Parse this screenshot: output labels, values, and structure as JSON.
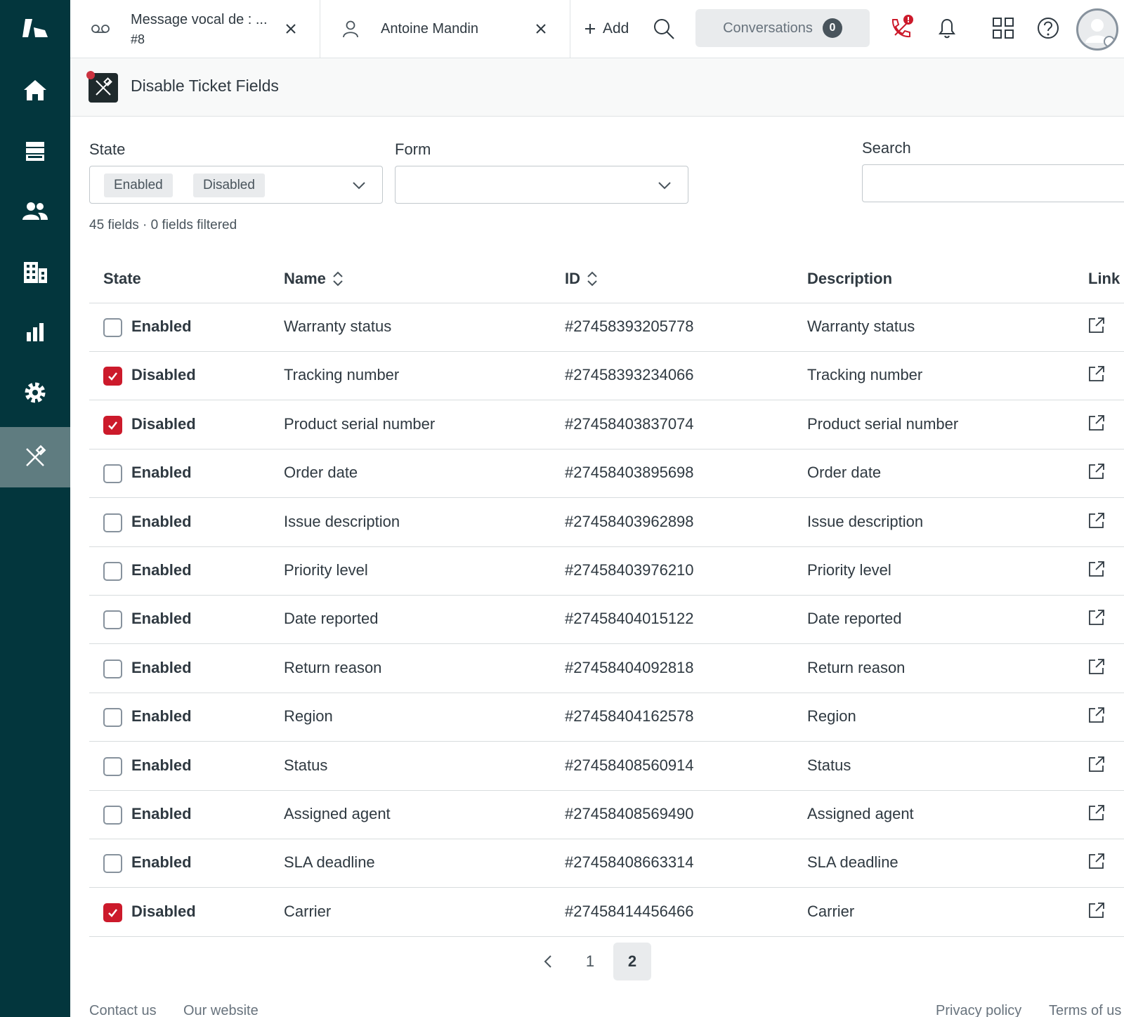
{
  "topbar": {
    "tabs": [
      {
        "title": "Message vocal de : ...",
        "sub": "#8"
      },
      {
        "title": "Antoine Mandin"
      }
    ],
    "add_label": "Add",
    "conversations_label": "Conversations",
    "conversations_count": "0"
  },
  "app": {
    "title": "Disable Ticket Fields"
  },
  "filters": {
    "state_label": "State",
    "state_chips": [
      "Enabled",
      "Disabled"
    ],
    "form_label": "Form",
    "search_label": "Search",
    "search_value": ""
  },
  "summary": "45 fields · 0 fields filtered",
  "table": {
    "headers": {
      "state": "State",
      "name": "Name",
      "id": "ID",
      "description": "Description",
      "link": "Link"
    },
    "rows": [
      {
        "checked": false,
        "state": "Enabled",
        "name": "Warranty status",
        "id": "#27458393205778",
        "description": "Warranty status"
      },
      {
        "checked": true,
        "state": "Disabled",
        "name": "Tracking number",
        "id": "#27458393234066",
        "description": "Tracking number"
      },
      {
        "checked": true,
        "state": "Disabled",
        "name": "Product serial number",
        "id": "#27458403837074",
        "description": "Product serial number"
      },
      {
        "checked": false,
        "state": "Enabled",
        "name": "Order date",
        "id": "#27458403895698",
        "description": "Order date"
      },
      {
        "checked": false,
        "state": "Enabled",
        "name": "Issue description",
        "id": "#27458403962898",
        "description": "Issue description"
      },
      {
        "checked": false,
        "state": "Enabled",
        "name": "Priority level",
        "id": "#27458403976210",
        "description": "Priority level"
      },
      {
        "checked": false,
        "state": "Enabled",
        "name": "Date reported",
        "id": "#27458404015122",
        "description": "Date reported"
      },
      {
        "checked": false,
        "state": "Enabled",
        "name": "Return reason",
        "id": "#27458404092818",
        "description": "Return reason"
      },
      {
        "checked": false,
        "state": "Enabled",
        "name": "Region",
        "id": "#27458404162578",
        "description": "Region"
      },
      {
        "checked": false,
        "state": "Enabled",
        "name": "Status",
        "id": "#27458408560914",
        "description": "Status"
      },
      {
        "checked": false,
        "state": "Enabled",
        "name": "Assigned agent",
        "id": "#27458408569490",
        "description": "Assigned agent"
      },
      {
        "checked": false,
        "state": "Enabled",
        "name": "SLA deadline",
        "id": "#27458408663314",
        "description": "SLA deadline"
      },
      {
        "checked": true,
        "state": "Disabled",
        "name": "Carrier",
        "id": "#27458414456466",
        "description": "Carrier"
      }
    ]
  },
  "pagination": {
    "pages": [
      "1",
      "2"
    ],
    "current": "2"
  },
  "footer": {
    "links_left": [
      "Contact us",
      "Our website"
    ],
    "links_right": [
      "Privacy policy",
      "Terms of us"
    ]
  },
  "colors": {
    "nav_bg": "#03363d",
    "nav_active": "#5f7c80",
    "accent_red": "#cc1a2b"
  }
}
